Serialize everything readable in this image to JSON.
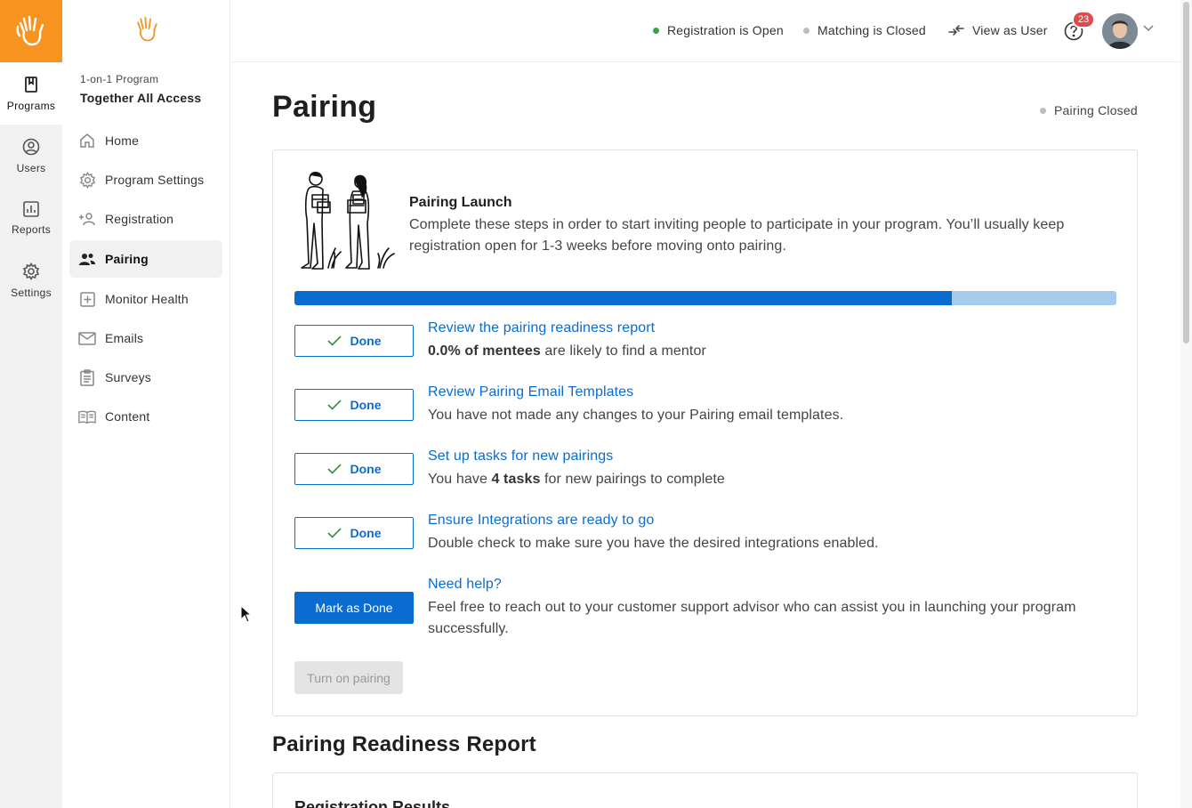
{
  "rail": {
    "items": [
      {
        "label": "Programs",
        "icon": "book-icon",
        "active": true
      },
      {
        "label": "Users",
        "icon": "user-circle-icon"
      },
      {
        "label": "Reports",
        "icon": "bar-chart-icon"
      },
      {
        "label": "Settings",
        "icon": "gear-icon"
      }
    ]
  },
  "sidebar": {
    "program_type": "1-on-1 Program",
    "program_name": "Together All Access",
    "items": [
      {
        "label": "Home",
        "icon": "home-icon"
      },
      {
        "label": "Program Settings",
        "icon": "gear-icon"
      },
      {
        "label": "Registration",
        "icon": "add-user-icon"
      },
      {
        "label": "Pairing",
        "icon": "users-icon",
        "active": true
      },
      {
        "label": "Monitor Health",
        "icon": "plus-square-icon"
      },
      {
        "label": "Emails",
        "icon": "mail-icon"
      },
      {
        "label": "Surveys",
        "icon": "clipboard-icon"
      },
      {
        "label": "Content",
        "icon": "open-book-icon"
      }
    ]
  },
  "topbar": {
    "registration_status": "Registration is Open",
    "matching_status": "Matching is Closed",
    "view_as_user": "View as User",
    "notifications_count": "23"
  },
  "colors": {
    "brand": "#f7931e",
    "accent": "#0a6cd1",
    "status_open": "#3aa34a",
    "status_closed": "#bdbdbd",
    "badge": "#e04a4a"
  },
  "page": {
    "title": "Pairing",
    "status": "Pairing Closed"
  },
  "launch": {
    "title": "Pairing Launch",
    "description": "Complete these steps in order to start inviting people to participate in your program. You’ll usually keep registration open for 1-3 weeks before moving onto pairing.",
    "progress_fraction": 0.8
  },
  "steps": [
    {
      "button": "Done",
      "link": "Review the pairing readiness report",
      "desc_bold": "0.0% of mentees",
      "desc_rest": " are likely to find a mentor"
    },
    {
      "button": "Done",
      "link": "Review Pairing Email Templates",
      "desc_pre": "You have not made any changes to your Pairing email templates."
    },
    {
      "button": "Done",
      "link": "Set up tasks for new pairings",
      "desc_pre": "You have ",
      "desc_bold": "4 tasks",
      "desc_rest": " for new pairings to complete"
    },
    {
      "button": "Done",
      "link": "Ensure Integrations are ready to go",
      "desc_pre": "Double check to make sure you have the desired integrations enabled."
    },
    {
      "button": "Mark as Done",
      "link": "Need help?",
      "desc_pre": "Feel free to reach out to your customer support advisor who can assist you in launching your program successfully."
    }
  ],
  "turn_on_button": "Turn on pairing",
  "readiness": {
    "heading": "Pairing Readiness Report",
    "card_title": "Registration Results"
  }
}
